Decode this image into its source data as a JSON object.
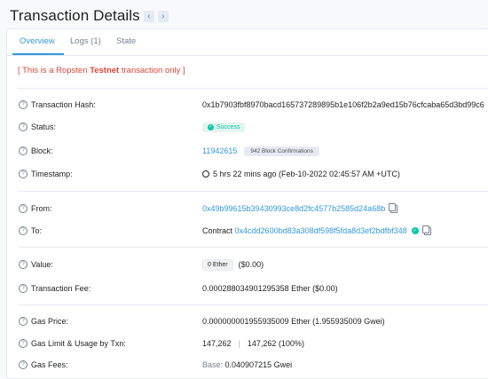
{
  "header": {
    "title": "Transaction Details",
    "prev": "‹",
    "next": "›"
  },
  "tabs": [
    {
      "label": "Overview",
      "active": true
    },
    {
      "label": "Logs (1)",
      "active": false
    },
    {
      "label": "State",
      "active": false
    }
  ],
  "notice": {
    "pre": "[ This is a Ropsten ",
    "bold": "Testnet",
    "post": " transaction only ]"
  },
  "fields": {
    "hash": {
      "label": "Transaction Hash:",
      "value": "0x1b7903fbf8970bacd165737289895b1e106f2b2a9ed15b76cfcaba65d3bd99c6"
    },
    "status": {
      "label": "Status:",
      "value": "Success"
    },
    "block": {
      "label": "Block:",
      "value": "11942615",
      "confirmations": "942 Block Confirmations"
    },
    "timestamp": {
      "label": "Timestamp:",
      "value": "5 hrs 22 mins ago (Feb-10-2022 02:45:57 AM +UTC)"
    },
    "from": {
      "label": "From:",
      "value": "0x49b99615b39430993ce8d2fc4577b2585d24a68b"
    },
    "to": {
      "label": "To:",
      "prefix": "Contract",
      "value": "0x4cdd2600bd83a308df598f5fda8d3ef2bdfbf348"
    },
    "value": {
      "label": "Value:",
      "badge": "0 Ether",
      "usd": "($0.00)"
    },
    "fee": {
      "label": "Transaction Fee:",
      "value": "0.000288034901295358 Ether ($0.00)"
    },
    "gas_price": {
      "label": "Gas Price:",
      "value": "0.000000001955935009 Ether (1.955935009 Gwei)"
    },
    "gas_limit": {
      "label": "Gas Limit & Usage by Txn:",
      "limit": "147,262",
      "sep": "|",
      "usage": "147,262 (100%)"
    },
    "gas_fees": {
      "label": "Gas Fees:",
      "base_label": "Base:",
      "base_value": "0.040907215 Gwei"
    }
  },
  "colors": {
    "accent": "#3498db",
    "success": "#00c9a7",
    "danger": "#de4437"
  }
}
